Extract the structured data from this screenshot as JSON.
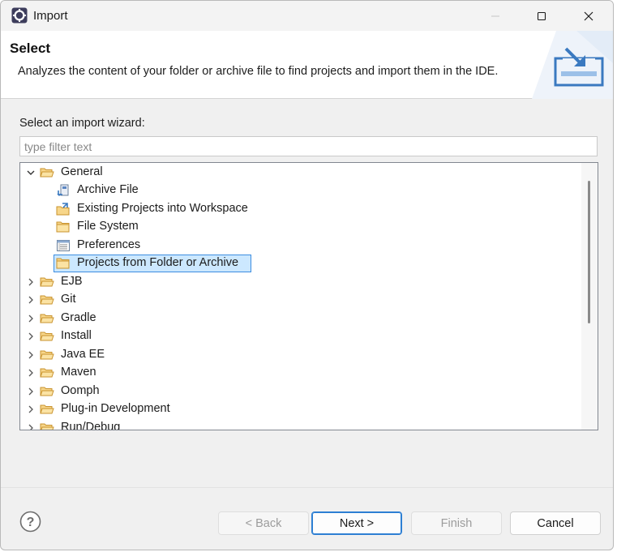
{
  "window": {
    "title": "Import",
    "icons": {
      "app": "eclipse-gear-icon",
      "minimize": "minimize-icon",
      "maximize": "maximize-icon",
      "close": "close-icon"
    }
  },
  "header": {
    "title": "Select",
    "description": "Analyzes the content of your folder or archive file to find projects and import them in the IDE.",
    "art_icon": "import-tray-icon"
  },
  "wizard": {
    "label": "Select an import wizard:",
    "filter_placeholder": "type filter text",
    "filter_value": ""
  },
  "tree": {
    "items": [
      {
        "label": "General",
        "level": 0,
        "expanded": true,
        "icon": "folder-open-icon"
      },
      {
        "label": "Archive File",
        "level": 1,
        "icon": "archive-file-icon"
      },
      {
        "label": "Existing Projects into Workspace",
        "level": 1,
        "icon": "existing-projects-icon"
      },
      {
        "label": "File System",
        "level": 1,
        "icon": "folder-icon"
      },
      {
        "label": "Preferences",
        "level": 1,
        "icon": "preferences-icon"
      },
      {
        "label": "Projects from Folder or Archive",
        "level": 1,
        "icon": "folder-icon",
        "selected": true
      },
      {
        "label": "EJB",
        "level": 0,
        "expanded": false,
        "icon": "folder-open-icon"
      },
      {
        "label": "Git",
        "level": 0,
        "expanded": false,
        "icon": "folder-open-icon"
      },
      {
        "label": "Gradle",
        "level": 0,
        "expanded": false,
        "icon": "folder-open-icon"
      },
      {
        "label": "Install",
        "level": 0,
        "expanded": false,
        "icon": "folder-open-icon"
      },
      {
        "label": "Java EE",
        "level": 0,
        "expanded": false,
        "icon": "folder-open-icon"
      },
      {
        "label": "Maven",
        "level": 0,
        "expanded": false,
        "icon": "folder-open-icon"
      },
      {
        "label": "Oomph",
        "level": 0,
        "expanded": false,
        "icon": "folder-open-icon"
      },
      {
        "label": "Plug-in Development",
        "level": 0,
        "expanded": false,
        "icon": "folder-open-icon"
      },
      {
        "label": "Run/Debug",
        "level": 0,
        "expanded": false,
        "icon": "folder-open-icon"
      }
    ]
  },
  "buttons": {
    "help_icon": "help-icon",
    "back": "< Back",
    "next": "Next >",
    "finish": "Finish",
    "cancel": "Cancel"
  }
}
